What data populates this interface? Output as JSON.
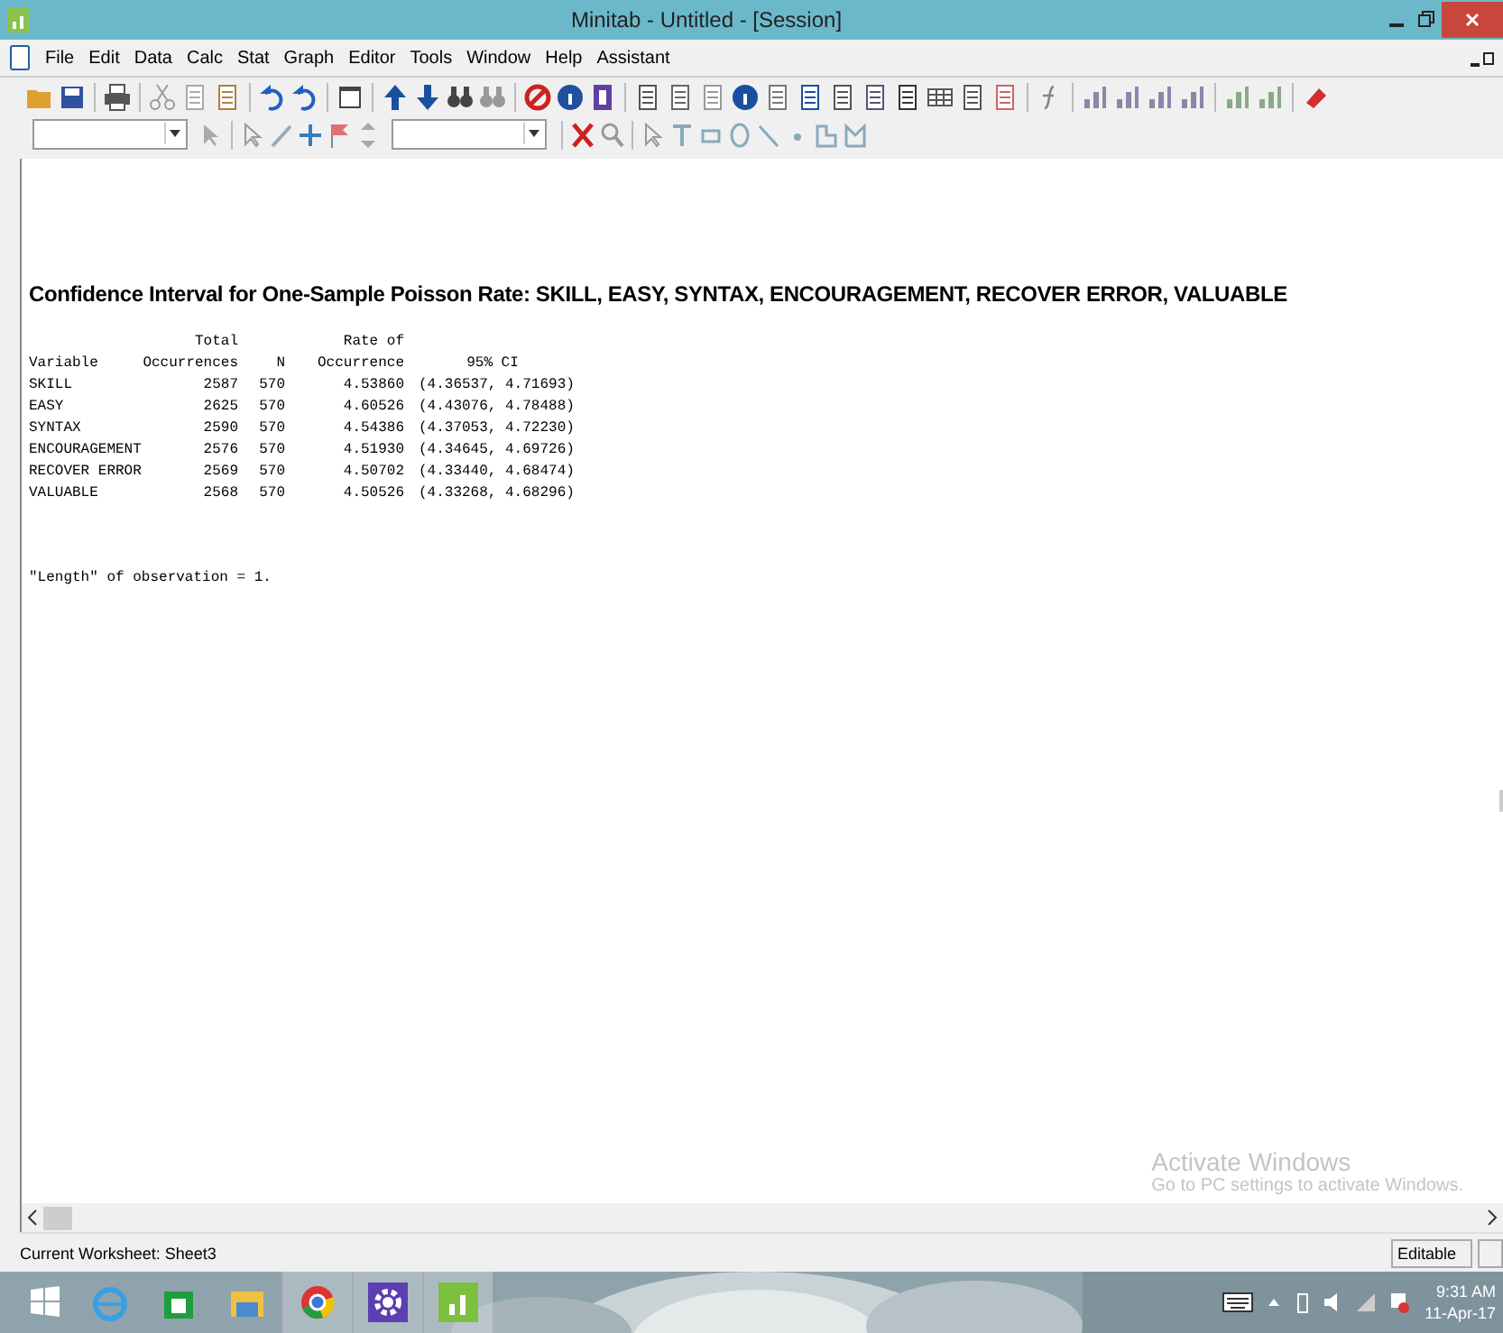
{
  "window": {
    "title": "Minitab - Untitled - [Session]"
  },
  "menu": [
    "File",
    "Edit",
    "Data",
    "Calc",
    "Stat",
    "Graph",
    "Editor",
    "Tools",
    "Window",
    "Help",
    "Assistant"
  ],
  "session": {
    "heading": "Confidence Interval for One-Sample Poisson Rate: SKILL, EASY, SYNTAX, ENCOURAGEMENT, RECOVER ERROR, VALUABLE",
    "columns": [
      {
        "label": "Variable"
      },
      {
        "top": "Total",
        "label": "Occurrences"
      },
      {
        "label": "N"
      },
      {
        "top": "Rate of",
        "label": "Occurrence"
      },
      {
        "label": "95% CI"
      }
    ],
    "rows": [
      [
        "SKILL",
        "2587",
        "570",
        "4.53860",
        "(4.36537, 4.71693)"
      ],
      [
        "EASY",
        "2625",
        "570",
        "4.60526",
        "(4.43076, 4.78488)"
      ],
      [
        "SYNTAX",
        "2590",
        "570",
        "4.54386",
        "(4.37053, 4.72230)"
      ],
      [
        "ENCOURAGEMENT",
        "2576",
        "570",
        "4.51930",
        "(4.34645, 4.69726)"
      ],
      [
        "RECOVER ERROR",
        "2569",
        "570",
        "4.50702",
        "(4.33440, 4.68474)"
      ],
      [
        "VALUABLE",
        "2568",
        "570",
        "4.50526",
        "(4.33268, 4.68296)"
      ]
    ],
    "note": "\"Length\" of observation = 1."
  },
  "watermark_notice": {
    "title": "Activate Windows",
    "text": "Go to PC settings to activate Windows."
  },
  "status_bar": {
    "worksheet": "Current Worksheet: Sheet3",
    "mode": "Editable"
  },
  "taskbar": {
    "apps": [
      {
        "kind": "ie",
        "running": false
      },
      {
        "kind": "store",
        "running": false
      },
      {
        "kind": "explorer",
        "running": false
      },
      {
        "kind": "chrome",
        "running": true
      },
      {
        "kind": "settings",
        "running": true
      },
      {
        "kind": "minitab",
        "running": true
      }
    ],
    "time": "9:31 AM",
    "date": "11-Apr-17"
  }
}
